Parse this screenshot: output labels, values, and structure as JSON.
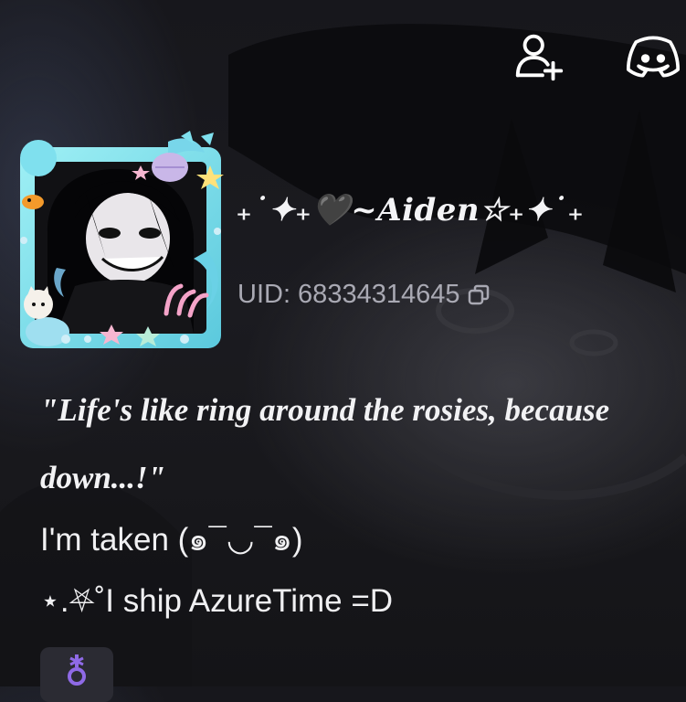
{
  "header": {
    "icons": [
      {
        "name": "add-friend-icon"
      },
      {
        "name": "discord-icon"
      }
    ]
  },
  "profile": {
    "nickname": "₊˙✦₊🖤~Aiden☆₊✦˙₊",
    "uid_label": "UID: 68334314645",
    "quote_line1": "\"Life's like ring around the rosies, because",
    "quote_line2": "down...!\"",
    "bio_line1": "I'm taken (๑¯◡¯๑)",
    "bio_line2": "⋆.⛧˚I ship AzureTime =D"
  },
  "colors": {
    "accent_badge_icon": "#8f6ae6",
    "frame_primary": "#7fe0ee",
    "uid_text": "#a9a9b3"
  }
}
